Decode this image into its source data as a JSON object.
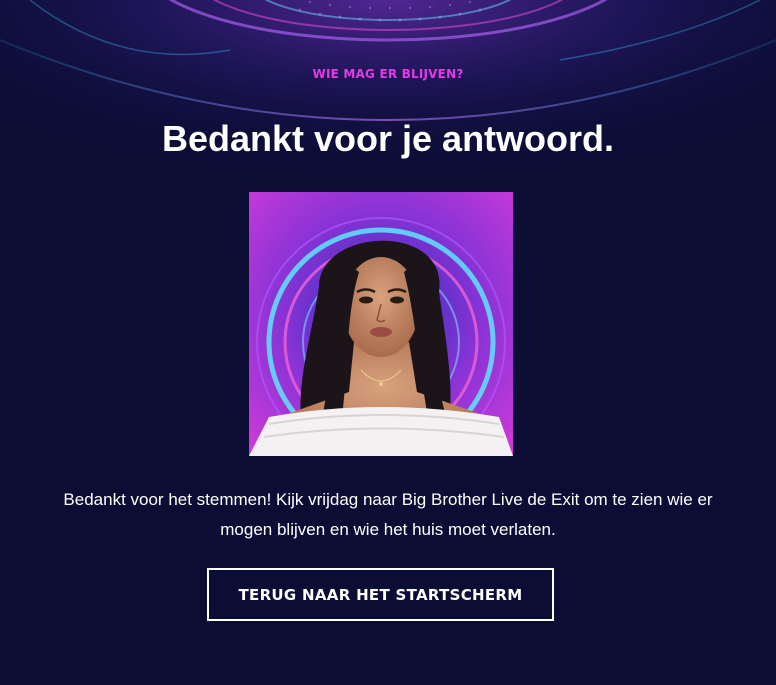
{
  "poll": {
    "eyebrow": "WIE MAG ER BLIJVEN?",
    "headline": "Bedankt voor je antwoord.",
    "message": "Bedankt voor het stemmen! Kijk vrijdag naar Big Brother Live de Exit om te zien wie er mogen blijven en wie het huis moet verlaten.",
    "back_button_label": "TERUG NAAR HET STARTSCHERM"
  },
  "colors": {
    "background": "#0b0d35",
    "accent": "#e23be6",
    "text": "#ffffff"
  },
  "icons": {
    "portrait": "contestant-photo"
  }
}
